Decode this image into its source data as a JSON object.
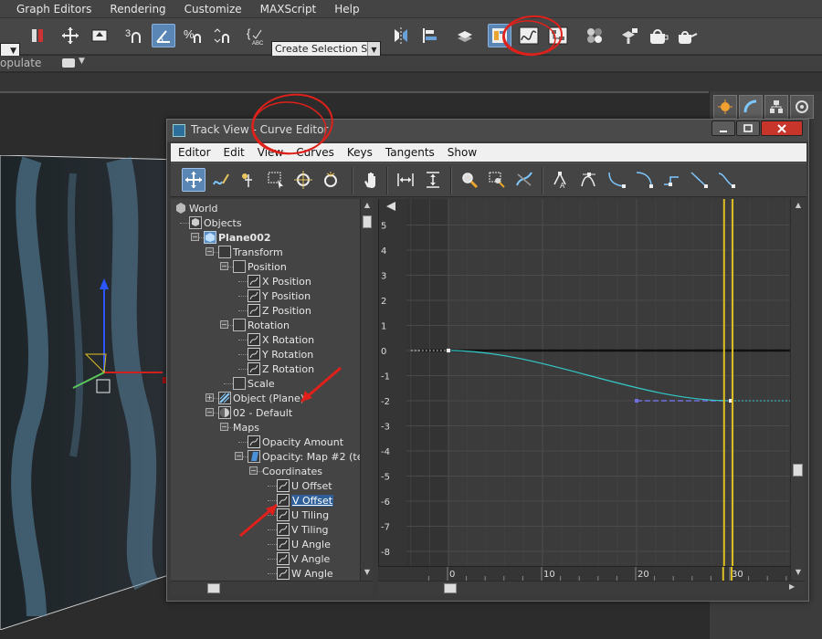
{
  "app": {
    "menubar": [
      "Graph Editors",
      "Rendering",
      "Customize",
      "MAXScript",
      "Help"
    ],
    "selection_set_placeholder": "Create Selection Se",
    "row2_label": "opulate"
  },
  "trackview": {
    "title": "Track View - Curve Editor",
    "menus": [
      "Editor",
      "Edit",
      "View",
      "Curves",
      "Keys",
      "Tangents",
      "Show"
    ],
    "tree": [
      {
        "label": "World",
        "depth": 0,
        "icon": "world",
        "expander": ""
      },
      {
        "label": "Objects",
        "depth": 1,
        "icon": "object",
        "expander": ""
      },
      {
        "label": "Plane002",
        "depth": 2,
        "icon": "cube",
        "expander": "-",
        "bold": true
      },
      {
        "label": "Transform",
        "depth": 3,
        "icon": "transform",
        "expander": "-"
      },
      {
        "label": "Position",
        "depth": 4,
        "icon": "position",
        "expander": "-"
      },
      {
        "label": "X Position",
        "depth": 5,
        "icon": "curve",
        "expander": ""
      },
      {
        "label": "Y Position",
        "depth": 5,
        "icon": "curve",
        "expander": ""
      },
      {
        "label": "Z Position",
        "depth": 5,
        "icon": "curve",
        "expander": ""
      },
      {
        "label": "Rotation",
        "depth": 4,
        "icon": "rotation",
        "expander": "-"
      },
      {
        "label": "X Rotation",
        "depth": 5,
        "icon": "curve",
        "expander": ""
      },
      {
        "label": "Y Rotation",
        "depth": 5,
        "icon": "curve",
        "expander": ""
      },
      {
        "label": "Z Rotation",
        "depth": 5,
        "icon": "curve",
        "expander": ""
      },
      {
        "label": "Scale",
        "depth": 4,
        "icon": "scale",
        "expander": ""
      },
      {
        "label": "Object (Plane)",
        "depth": 3,
        "icon": "plane",
        "expander": "+"
      },
      {
        "label": "02 - Default",
        "depth": 3,
        "icon": "material",
        "expander": "-"
      },
      {
        "label": "Maps",
        "depth": 4,
        "icon": "none",
        "expander": "-"
      },
      {
        "label": "Opacity Amount",
        "depth": 5,
        "icon": "curve",
        "expander": ""
      },
      {
        "label": "Opacity: Map #2 (te",
        "depth": 5,
        "icon": "map",
        "expander": "-"
      },
      {
        "label": "Coordinates",
        "depth": 6,
        "icon": "none",
        "expander": "-"
      },
      {
        "label": "U Offset",
        "depth": 7,
        "icon": "curve",
        "expander": ""
      },
      {
        "label": "V Offset",
        "depth": 7,
        "icon": "curve",
        "expander": "",
        "selected": true
      },
      {
        "label": "U Tiling",
        "depth": 7,
        "icon": "curve",
        "expander": ""
      },
      {
        "label": "V Tiling",
        "depth": 7,
        "icon": "curve",
        "expander": ""
      },
      {
        "label": "U Angle",
        "depth": 7,
        "icon": "curve",
        "expander": ""
      },
      {
        "label": "V Angle",
        "depth": 7,
        "icon": "curve",
        "expander": ""
      },
      {
        "label": "W Angle",
        "depth": 7,
        "icon": "curve",
        "expander": ""
      }
    ],
    "graph": {
      "y_ticks": [
        "5",
        "4",
        "3",
        "2",
        "1",
        "0",
        "-1",
        "-2",
        "-3",
        "-4",
        "-5",
        "-6",
        "-7",
        "-8"
      ],
      "x_ticks": [
        "0",
        "10",
        "20",
        "30"
      ],
      "curve_color": "#33c9c9",
      "tangent_color": "#7070e0",
      "time_marker_color": "#e0c020",
      "keys": [
        {
          "frame": 0,
          "value": 0
        },
        {
          "frame": 30,
          "value": -2
        }
      ],
      "time_marker_frames": [
        29.3,
        30.2
      ]
    }
  },
  "annotation_color": "#e0201a"
}
